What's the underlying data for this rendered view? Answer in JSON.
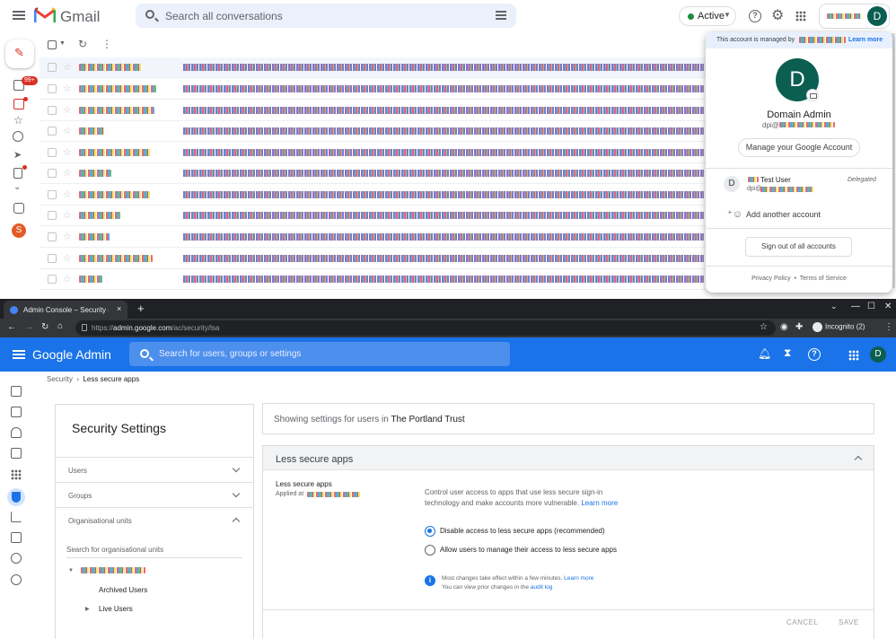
{
  "gmail": {
    "app_name": "Gmail",
    "search_placeholder": "Search all conversations",
    "status": "Active",
    "account_initial": "D",
    "inbox_badge": "99+",
    "side_avatar_initial": "S",
    "popup": {
      "managed_text": "This account is managed by",
      "learn_more": "Learn more",
      "avatar_initial": "D",
      "name": "Domain Admin",
      "email_prefix": "dpi@",
      "manage_button": "Manage your Google Account",
      "other_initial": "D",
      "other_name": "Test User",
      "other_email_prefix": "dpi@",
      "delegated": "Delegated",
      "add_account": "Add another account",
      "sign_out": "Sign out of all accounts",
      "privacy": "Privacy Policy",
      "separator": "•",
      "terms": "Terms of Service"
    }
  },
  "browser": {
    "tab_title": "Admin Console – Security – Set",
    "tab_close": "×",
    "new_tab": "+",
    "url_prefix": "https://",
    "url_host": "admin.google.com",
    "url_path": "/ac/security/lsa",
    "incognito": "Incognito (2)"
  },
  "admin": {
    "title": "Google Admin",
    "search_placeholder": "Search for users, groups or settings",
    "avatar_initial": "D",
    "breadcrumb": {
      "parent": "Security",
      "sep": "›",
      "current": "Less secure apps"
    },
    "left_panel": {
      "title": "Security Settings",
      "rows": [
        "Users",
        "Groups",
        "Organisational units"
      ],
      "ou_search": "Search for organisational units",
      "ou_children": [
        "Archived Users",
        "Live Users"
      ]
    },
    "showing_prefix": "Showing settings for users in",
    "org_name": "The Portland Trust",
    "section_title": "Less secure apps",
    "setting_label": "Less secure apps",
    "applied_at": "Applied at",
    "description": "Control user access to apps that use less secure sign-in technology and make accounts more vulnerable.",
    "description_link": "Learn more",
    "options": [
      {
        "label": "Disable access to less secure apps (recommended)",
        "selected": true
      },
      {
        "label": "Allow users to manage their access to less secure apps",
        "selected": false
      }
    ],
    "info_line1": "Most changes take effect within a few minutes.",
    "info_link1": "Learn more",
    "info_line2": "You can view prior changes in the",
    "info_link2": "audit log",
    "cancel": "CANCEL",
    "save": "SAVE"
  },
  "colors": {
    "gmail_red": "#ea4335",
    "admin_blue": "#1a73e8",
    "avatar_green": "#0b5e50"
  }
}
